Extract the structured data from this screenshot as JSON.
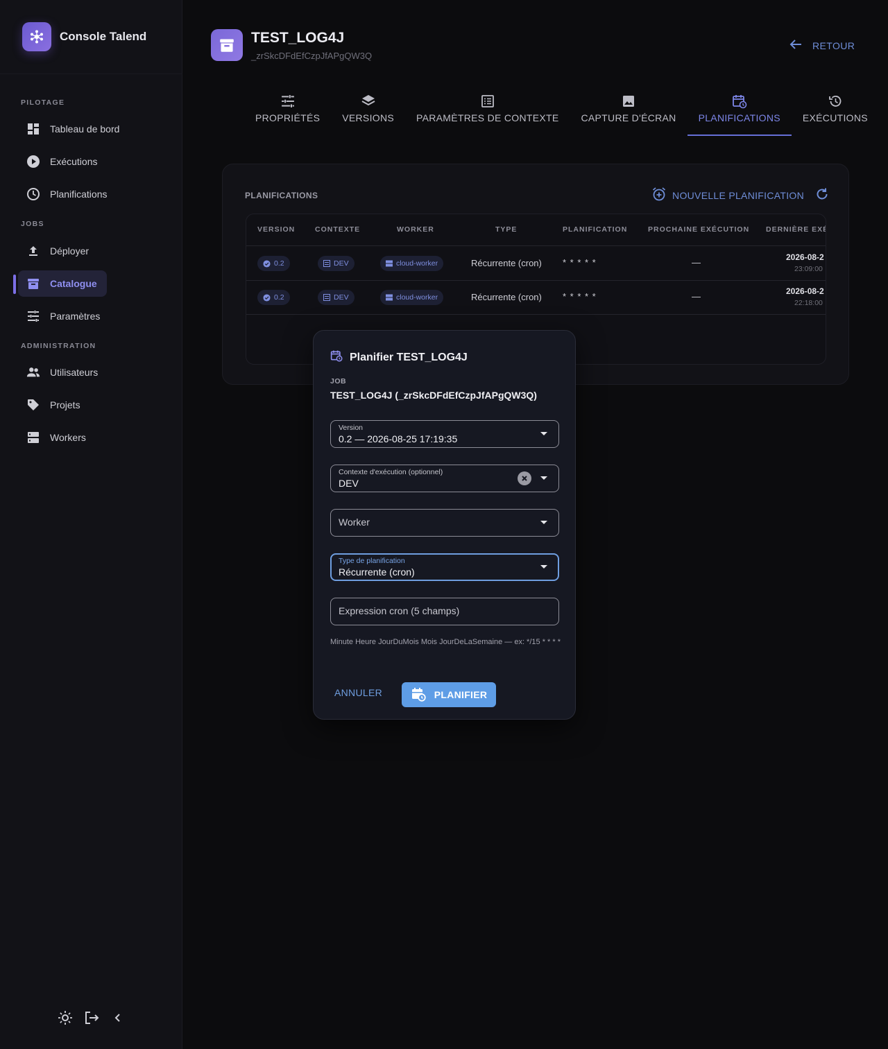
{
  "app": {
    "title": "Console Talend"
  },
  "sidebar": {
    "sections": [
      {
        "label": "PILOTAGE"
      },
      {
        "label": "JOBS"
      },
      {
        "label": "ADMINISTRATION"
      }
    ],
    "items": [
      {
        "label": "Tableau de bord",
        "icon": "dashboard-icon"
      },
      {
        "label": "Exécutions",
        "icon": "play-circle-icon"
      },
      {
        "label": "Planifications",
        "icon": "clock-icon"
      },
      {
        "label": "Déployer",
        "icon": "upload-icon"
      },
      {
        "label": "Catalogue",
        "icon": "archive-icon",
        "active": true
      },
      {
        "label": "Paramètres",
        "icon": "sliders-icon"
      },
      {
        "label": "Utilisateurs",
        "icon": "users-icon"
      },
      {
        "label": "Projets",
        "icon": "tag-icon"
      },
      {
        "label": "Workers",
        "icon": "server-icon"
      }
    ]
  },
  "header": {
    "job_name": "TEST_LOG4J",
    "job_id": "_zrSkcDFdEfCzpJfAPgQW3Q",
    "back_label": "RETOUR"
  },
  "tabs": [
    {
      "label": "PROPRIÉTÉS",
      "icon": "tune-icon"
    },
    {
      "label": "VERSIONS",
      "icon": "layers-icon"
    },
    {
      "label": "PARAMÈTRES DE CONTEXTE",
      "icon": "list-icon"
    },
    {
      "label": "CAPTURE D'ÉCRAN",
      "icon": "image-icon"
    },
    {
      "label": "PLANIFICATIONS",
      "icon": "calendar-clock-icon",
      "active": true
    },
    {
      "label": "EXÉCUTIONS",
      "icon": "history-icon"
    }
  ],
  "schedules": {
    "label": "PLANIFICATIONS",
    "new_label": "NOUVELLE PLANIFICATION",
    "columns": [
      "VERSION",
      "CONTEXTE",
      "WORKER",
      "TYPE",
      "PLANIFICATION",
      "PROCHAINE EXÉCUTION",
      "DERNIÈRE EXÉC"
    ],
    "rows": [
      {
        "version": "0.2",
        "context": "DEV",
        "worker": "cloud-worker",
        "type": "Récurrente (cron)",
        "cron": "* * * * *",
        "next": "—",
        "last_date": "2026-08-2",
        "last_time": "23:09:00"
      },
      {
        "version": "0.2",
        "context": "DEV",
        "worker": "cloud-worker",
        "type": "Récurrente (cron)",
        "cron": "* * * * *",
        "next": "—",
        "last_date": "2026-08-2",
        "last_time": "22:18:00"
      }
    ]
  },
  "dialog": {
    "title": "Planifier TEST_LOG4J",
    "job_label": "JOB",
    "job_value": "TEST_LOG4J (_zrSkcDFdEfCzpJfAPgQW3Q)",
    "version": {
      "label": "Version",
      "value": "0.2 — 2026-08-25 17:19:35"
    },
    "context": {
      "label": "Contexte d'exécution (optionnel)",
      "value": "DEV"
    },
    "worker": {
      "placeholder": "Worker"
    },
    "schedule_type": {
      "label": "Type de planification",
      "value": "Récurrente (cron)"
    },
    "cron": {
      "placeholder": "Expression cron (5 champs)"
    },
    "helper": "Minute Heure JourDuMois Mois JourDeLaSemaine — ex: */15 * * * *",
    "cancel_label": "ANNULER",
    "submit_label": "PLANIFIER"
  },
  "colors": {
    "accent": "#7c6fe6",
    "primary_button": "#5e9de6",
    "link": "#6f8ed8",
    "background": "#0c0c0e"
  }
}
